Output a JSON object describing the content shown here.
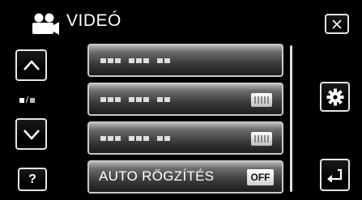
{
  "header": {
    "title": "VIDEÓ",
    "mode_icon": "video-camera-icon"
  },
  "left_nav": {
    "up_icon": "chevron-up-icon",
    "down_icon": "chevron-down-icon",
    "help_label": "?"
  },
  "right_nav": {
    "close_icon": "close-icon",
    "settings_icon": "gear-icon",
    "back_icon": "return-arrow-icon"
  },
  "menu": {
    "items": [
      {
        "label": "",
        "value_icon": ""
      },
      {
        "label": "",
        "value_icon": "setting-icon"
      },
      {
        "label": "",
        "value_icon": "setting-icon"
      },
      {
        "label": "AUTO RÖGZÍTÉS",
        "value": "OFF"
      }
    ]
  },
  "colors": {
    "background": "#000000",
    "item_border": "#c9c9c9",
    "text": "#ffffff"
  }
}
